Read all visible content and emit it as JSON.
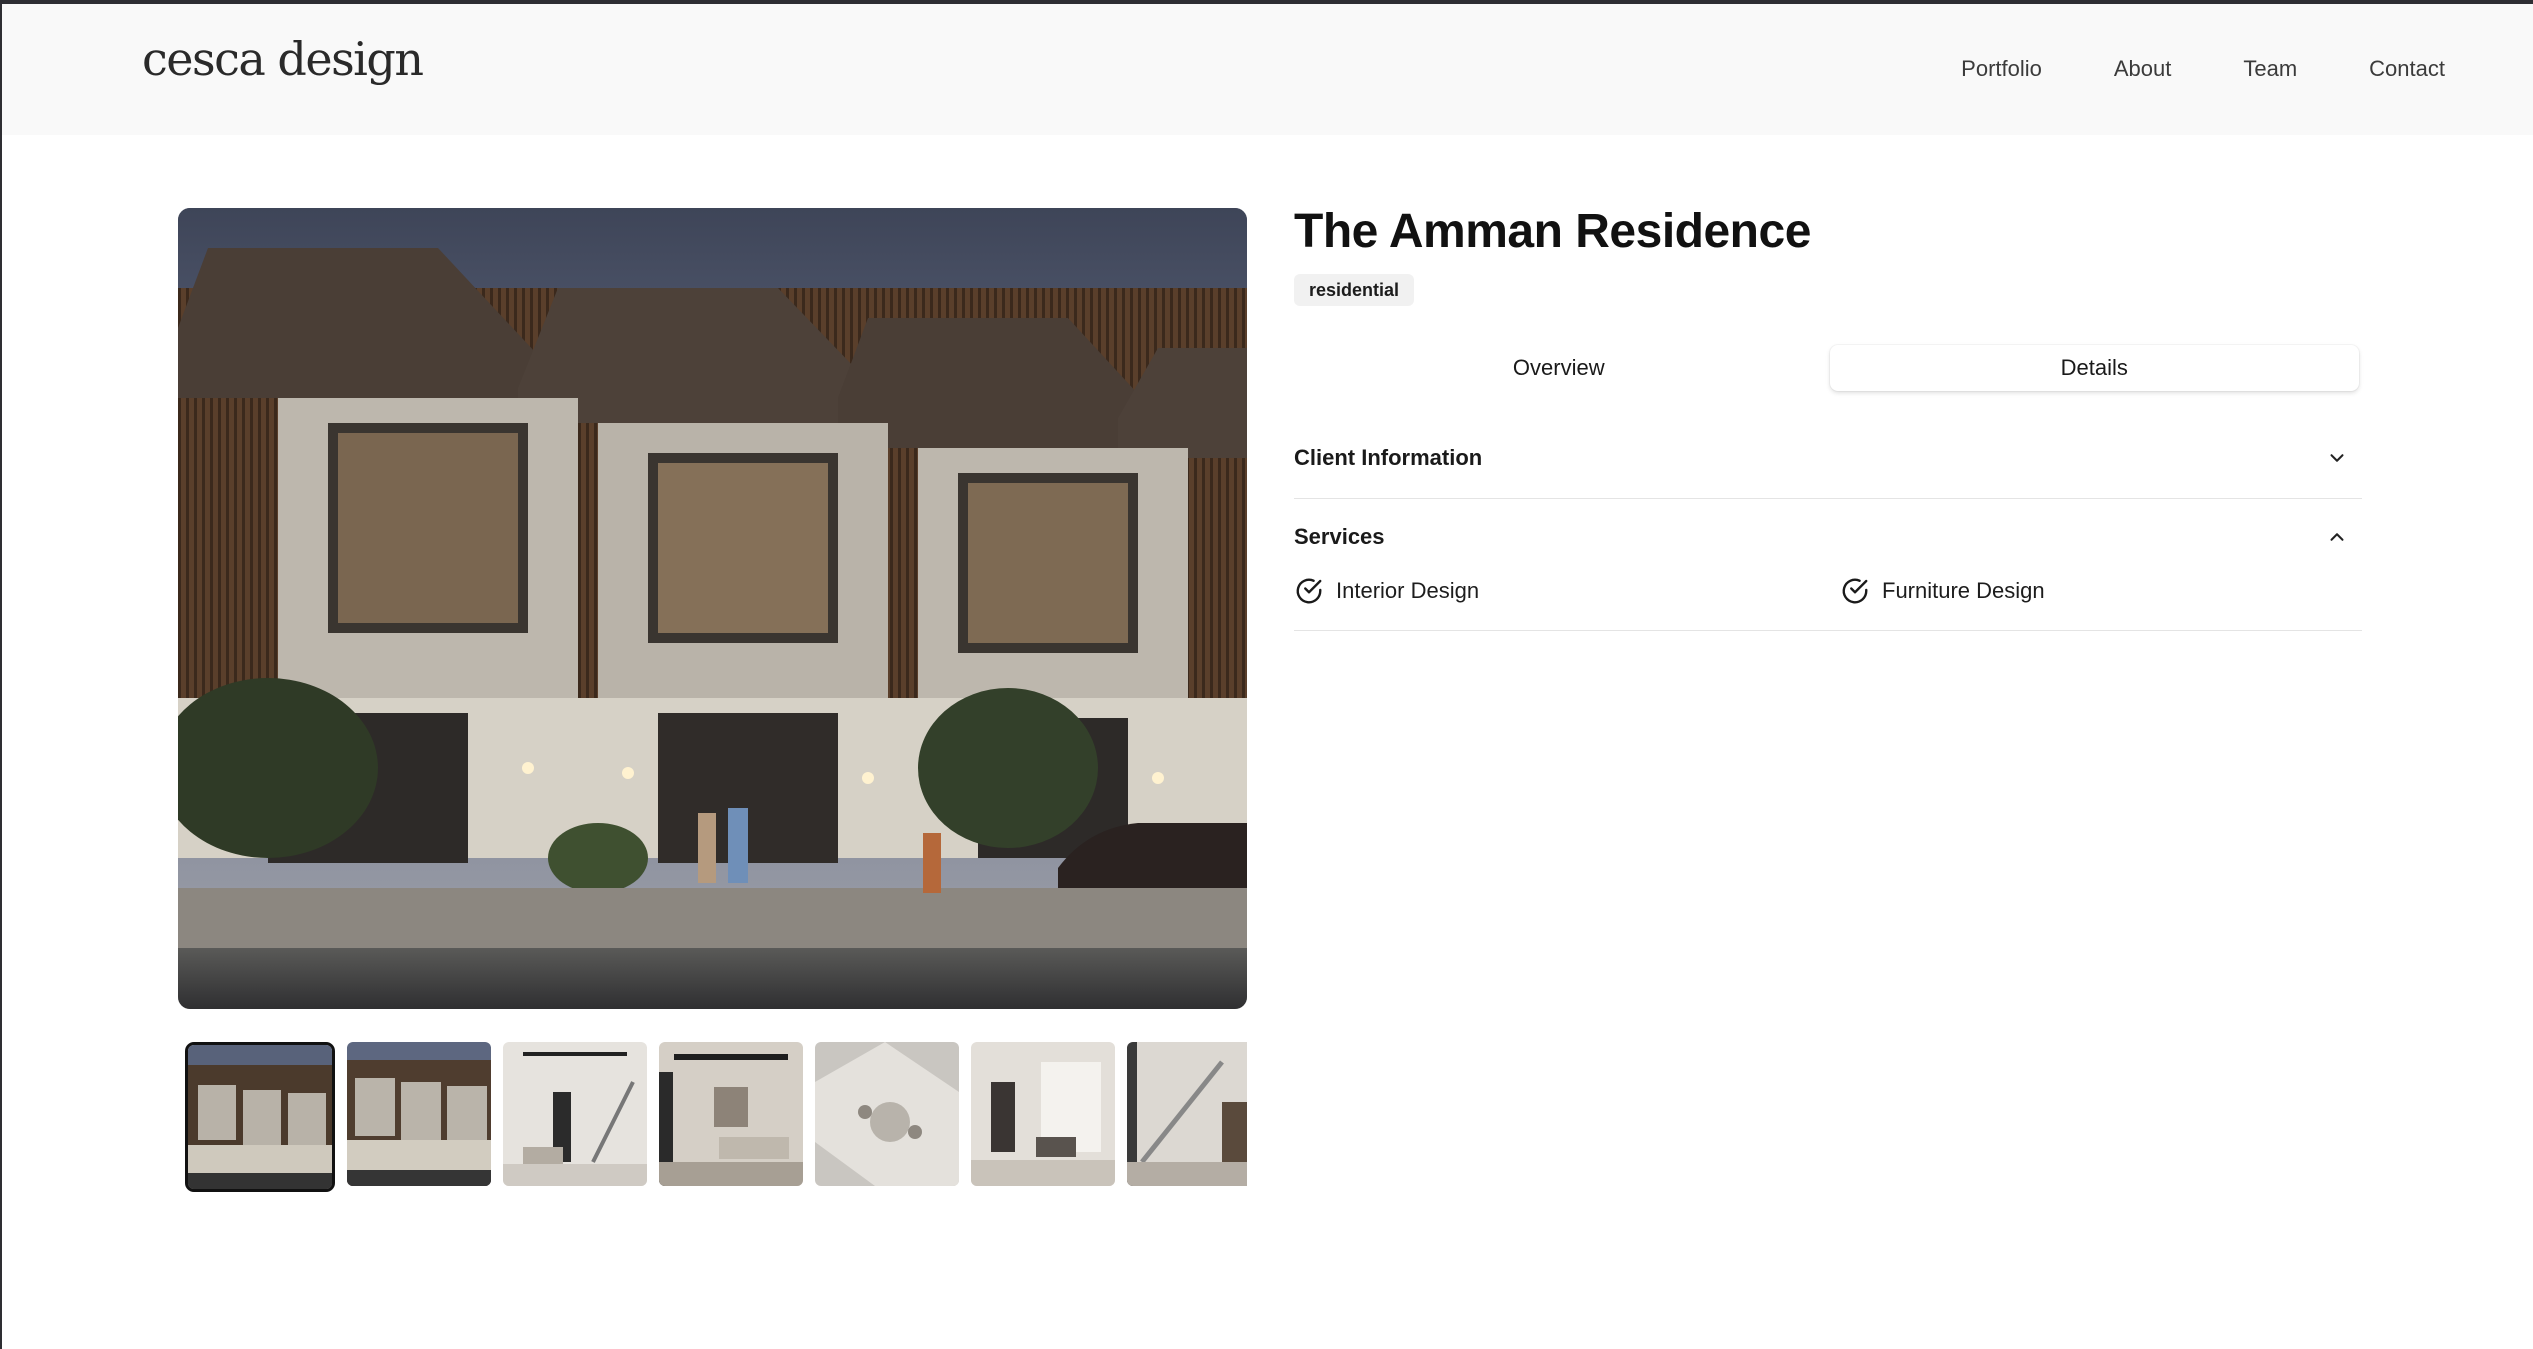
{
  "brand": {
    "logo_text": "cesca design"
  },
  "nav": {
    "items": [
      "Portfolio",
      "About",
      "Team",
      "Contact"
    ]
  },
  "project": {
    "title": "The Amman Residence",
    "category": "residential"
  },
  "gallery": {
    "main_image": "townhouse-exterior-render",
    "thumbnails": [
      "townhouse-exterior-render",
      "townhouse-exterior-render-alt",
      "interior-living-staircase",
      "interior-living-room",
      "interior-top-view-dining",
      "interior-bedroom-window",
      "interior-staircase-kitchen"
    ],
    "active_index": 0
  },
  "tabs": {
    "items": [
      "Overview",
      "Details"
    ],
    "selected": "Details"
  },
  "sections": {
    "client": {
      "label": "Client Information",
      "state": "collapsed"
    },
    "services": {
      "label": "Services",
      "state": "expanded",
      "items": [
        "Interior Design",
        "Furniture Design"
      ]
    }
  },
  "icons": {
    "collapsed": "chevron-down-icon",
    "expanded": "chevron-up-icon",
    "service": "check-circle-icon"
  },
  "colors": {
    "header_bg": "#f9f9f9",
    "badge_bg": "#f1f1f1",
    "text": "#1a1a1a"
  }
}
